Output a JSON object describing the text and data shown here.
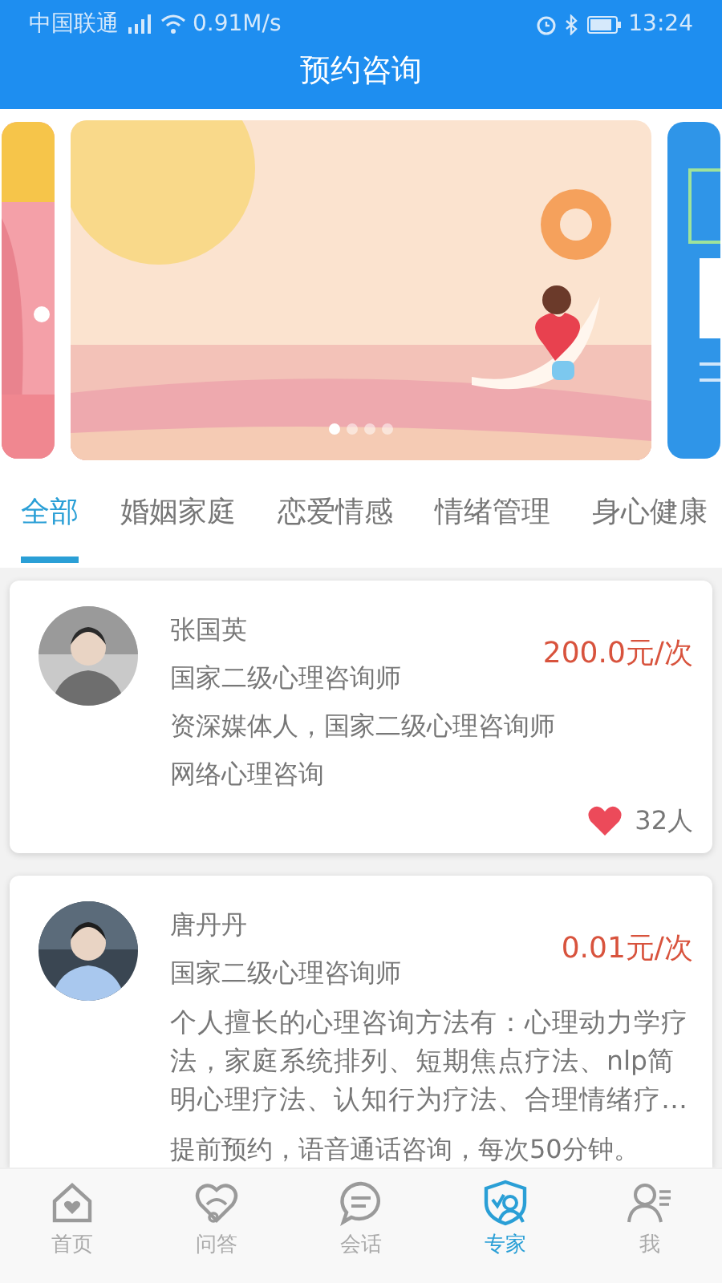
{
  "status_bar": {
    "carrier": "中国联通",
    "speed": "0.91M/s",
    "time": "13:24"
  },
  "header": {
    "title": "预约咨询"
  },
  "carousel_dots": [
    {
      "selected": true
    },
    {
      "selected": false
    },
    {
      "selected": false
    },
    {
      "selected": false
    }
  ],
  "tabs": [
    {
      "label": "全部",
      "selected": true
    },
    {
      "label": "婚姻家庭",
      "selected": false
    },
    {
      "label": "恋爱情感",
      "selected": false
    },
    {
      "label": "情绪管理",
      "selected": false
    },
    {
      "label": "身心健康",
      "selected": false
    }
  ],
  "experts": [
    {
      "name": "张国英",
      "title": "国家二级心理咨询师",
      "price": "200.0元/次",
      "description": "资深媒体人，国家二级心理咨询师",
      "service": "网络心理咨询",
      "likes": "32人"
    },
    {
      "name": "唐丹丹",
      "title": "国家二级心理咨询师",
      "price": "0.01元/次",
      "description": "个人擅长的心理咨询方法有：心理动力学疗法，家庭系统排列、短期焦点疗法、nlp简明心理疗法、认知行为疗法、合理情绪疗…",
      "service": "提前预约，语音通话咨询，每次50分钟。"
    }
  ],
  "bottom_nav": [
    {
      "label": "首页",
      "kind": "home",
      "selected": false
    },
    {
      "label": "问答",
      "kind": "qa",
      "selected": false
    },
    {
      "label": "会话",
      "kind": "chat",
      "selected": false
    },
    {
      "label": "专家",
      "kind": "expert",
      "selected": true
    },
    {
      "label": "我",
      "kind": "me",
      "selected": false
    }
  ]
}
